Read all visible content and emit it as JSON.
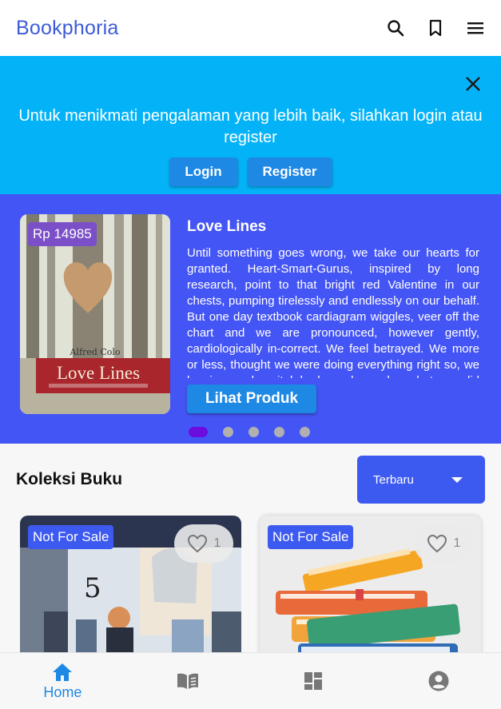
{
  "header": {
    "brand": "Bookphoria",
    "icons": [
      "search-icon",
      "bookmark-icon",
      "menu-icon"
    ],
    "brand_color": "#3d5bd9"
  },
  "login_banner": {
    "message": "Untuk menikmati pengalaman yang lebih baik, silahkan login atau register",
    "login_label": "Login",
    "register_label": "Register",
    "bg_color": "#04b3f7"
  },
  "featured": {
    "price": "Rp 14985",
    "title": "Love Lines",
    "description": "Until something goes wrong, we take our hearts for granted. Heart-Smart-Gurus, inspired by long research, point to that bright red Valentine in our chests, pumping tirelessly and endlessly on our behalf. But one day textbook cardiagram wiggles, veer off the chart and we are pronounced, however gently, cardiologically in-correct. We feel betrayed. We more or less, thought we were doing everything right so, we lay in our hospital beds and wonder what we did wrong.",
    "cover_title": "Love Lines",
    "cover_author": "Alfred Colo",
    "button_label": "Lihat Produk",
    "slide_count": 5,
    "active_slide": 1,
    "bg_color": "#4455f5"
  },
  "collection": {
    "title": "Koleksi Buku",
    "sort_value": "Terbaru",
    "cards": [
      {
        "badge": "Not For Sale",
        "likes": "1"
      },
      {
        "badge": "Not For Sale",
        "likes": "1"
      }
    ]
  },
  "bottom_nav": {
    "items": [
      {
        "icon": "home-icon",
        "label": "Home",
        "active": true
      },
      {
        "icon": "book-open-icon",
        "label": "",
        "active": false
      },
      {
        "icon": "dashboard-icon",
        "label": "",
        "active": false
      },
      {
        "icon": "account-icon",
        "label": "",
        "active": false
      }
    ],
    "active_color": "#1e88e5"
  }
}
